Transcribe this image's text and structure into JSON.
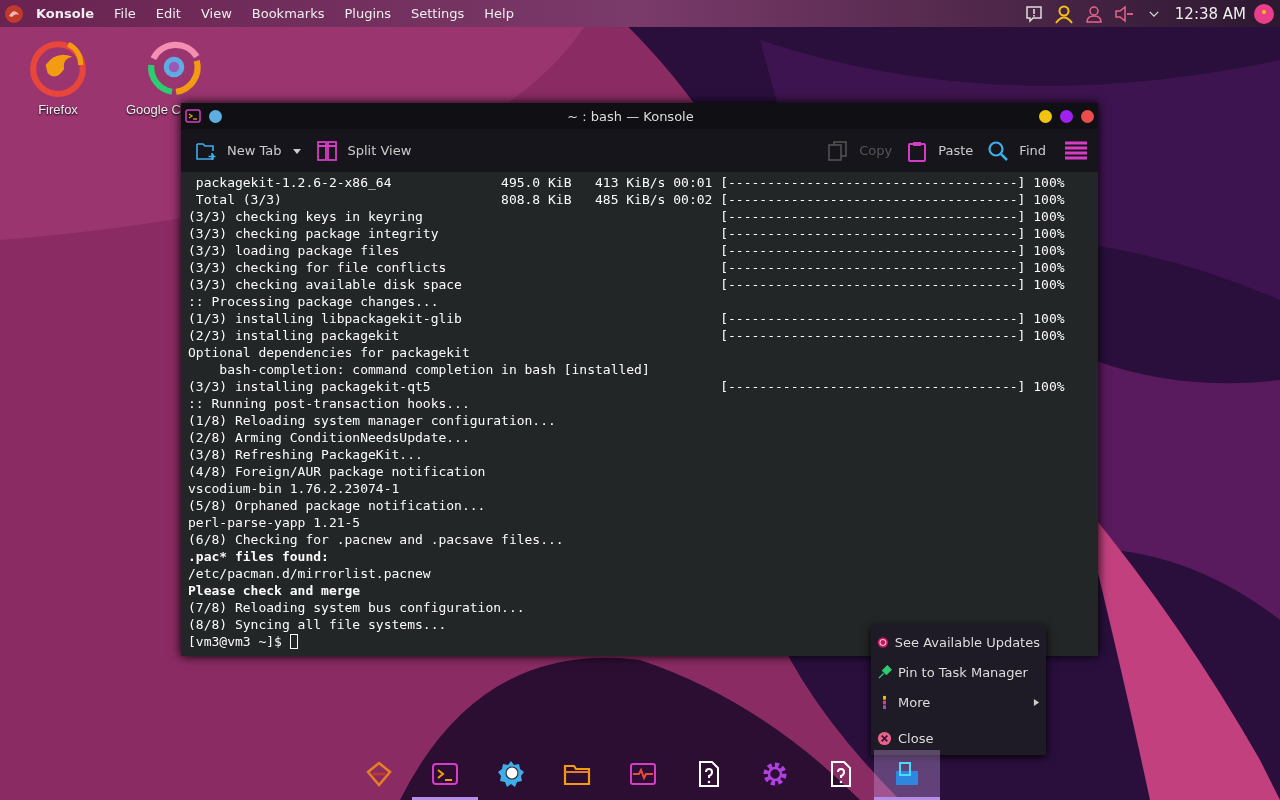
{
  "top_panel": {
    "app_name": "Konsole",
    "menu": [
      "File",
      "Edit",
      "View",
      "Bookmarks",
      "Plugins",
      "Settings",
      "Help"
    ],
    "clock": "12:38 AM"
  },
  "desktop_icons": [
    {
      "kind": "firefox",
      "label": "Firefox"
    },
    {
      "kind": "chrome",
      "label": "Google C"
    }
  ],
  "window": {
    "title": "~ : bash — Konsole",
    "toolbar": [
      {
        "kind": "new-tab",
        "label": "New Tab",
        "disabled": false,
        "dropdown": true
      },
      {
        "kind": "split",
        "label": "Split View",
        "disabled": false,
        "dropdown": false
      },
      {
        "kind": "copy",
        "label": "Copy",
        "disabled": true,
        "dropdown": false
      },
      {
        "kind": "paste",
        "label": "Paste",
        "disabled": false,
        "dropdown": false
      },
      {
        "kind": "find",
        "label": "Find",
        "disabled": false,
        "dropdown": false
      }
    ],
    "lines": [
      {
        "text": " packagekit-1.2.6-2-x86_64              495.0 KiB   413 KiB/s 00:01",
        "bold": false,
        "progress": "[-------------------------------------]",
        "percent": "100%"
      },
      {
        "text": " Total (3/3)                            808.8 KiB   485 KiB/s 00:02",
        "bold": false,
        "progress": "[-------------------------------------]",
        "percent": "100%"
      },
      {
        "text": "(3/3) checking keys in keyring",
        "bold": false,
        "progress": "[-------------------------------------]",
        "percent": "100%"
      },
      {
        "text": "(3/3) checking package integrity",
        "bold": false,
        "progress": "[-------------------------------------]",
        "percent": "100%"
      },
      {
        "text": "(3/3) loading package files",
        "bold": false,
        "progress": "[-------------------------------------]",
        "percent": "100%"
      },
      {
        "text": "(3/3) checking for file conflicts",
        "bold": false,
        "progress": "[-------------------------------------]",
        "percent": "100%"
      },
      {
        "text": "(3/3) checking available disk space",
        "bold": false,
        "progress": "[-------------------------------------]",
        "percent": "100%"
      },
      {
        "text": ":: Processing package changes...",
        "bold": false
      },
      {
        "text": "(1/3) installing libpackagekit-glib",
        "bold": false,
        "progress": "[-------------------------------------]",
        "percent": "100%"
      },
      {
        "text": "(2/3) installing packagekit",
        "bold": false,
        "progress": "[-------------------------------------]",
        "percent": "100%"
      },
      {
        "text": "Optional dependencies for packagekit",
        "bold": false
      },
      {
        "text": "    bash-completion: command completion in bash [installed]",
        "bold": false
      },
      {
        "text": "(3/3) installing packagekit-qt5",
        "bold": false,
        "progress": "[-------------------------------------]",
        "percent": "100%"
      },
      {
        "text": ":: Running post-transaction hooks...",
        "bold": false
      },
      {
        "text": "(1/8) Reloading system manager configuration...",
        "bold": false
      },
      {
        "text": "(2/8) Arming ConditionNeedsUpdate...",
        "bold": false
      },
      {
        "text": "(3/8) Refreshing PackageKit...",
        "bold": false
      },
      {
        "text": "(4/8) Foreign/AUR package notification",
        "bold": false
      },
      {
        "text": "vscodium-bin 1.76.2.23074-1",
        "bold": false
      },
      {
        "text": "(5/8) Orphaned package notification...",
        "bold": false
      },
      {
        "text": "perl-parse-yapp 1.21-5",
        "bold": false
      },
      {
        "text": "(6/8) Checking for .pacnew and .pacsave files...",
        "bold": false
      },
      {
        "text": ".pac* files found:",
        "bold": true
      },
      {
        "text": "/etc/pacman.d/mirrorlist.pacnew",
        "bold": false
      },
      {
        "text": "Please check and merge",
        "bold": true
      },
      {
        "text": "(7/8) Reloading system bus configuration...",
        "bold": false
      },
      {
        "text": "(8/8) Syncing all file systems...",
        "bold": false
      },
      {
        "text": "[vm3@vm3 ~]$ ",
        "bold": false,
        "cursor": true
      }
    ]
  },
  "context_menu": [
    {
      "kind": "updates",
      "label": "See Available Updates",
      "submenu": false,
      "separator_before": false
    },
    {
      "kind": "pin",
      "label": "Pin to Task Manager",
      "submenu": false,
      "separator_before": false
    },
    {
      "kind": "more",
      "label": "More",
      "submenu": true,
      "separator_before": false
    },
    {
      "kind": "close",
      "label": "Close",
      "submenu": false,
      "separator_before": true
    }
  ],
  "taskbar": [
    {
      "kind": "launcher",
      "active": false,
      "highlighted": false
    },
    {
      "kind": "terminal",
      "active": true,
      "highlighted": false
    },
    {
      "kind": "network",
      "active": false,
      "highlighted": false
    },
    {
      "kind": "folder",
      "active": false,
      "highlighted": false
    },
    {
      "kind": "monitor",
      "active": false,
      "highlighted": false
    },
    {
      "kind": "unknown",
      "active": false,
      "highlighted": false
    },
    {
      "kind": "settings",
      "active": false,
      "highlighted": false
    },
    {
      "kind": "unknown",
      "active": false,
      "highlighted": false
    },
    {
      "kind": "store",
      "active": false,
      "highlighted": true
    }
  ]
}
